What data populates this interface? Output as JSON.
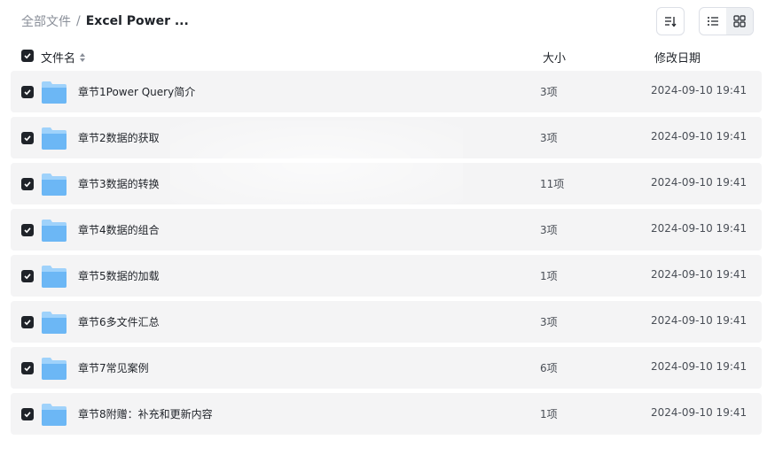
{
  "breadcrumb": {
    "root": "全部文件",
    "separator": "/",
    "current": "Excel Power ..."
  },
  "toolbar": {
    "sort_icon": "sort-icon",
    "list_view_icon": "list-view-icon",
    "grid_view_icon": "grid-view-icon",
    "active_view": "list"
  },
  "table": {
    "headers": {
      "name": "文件名",
      "size": "大小",
      "date": "修改日期"
    },
    "rows": [
      {
        "name": "章节1Power Query简介",
        "size": "3项",
        "date": "2024-09-10 19:41"
      },
      {
        "name": "章节2数据的获取",
        "size": "3项",
        "date": "2024-09-10 19:41"
      },
      {
        "name": "章节3数据的转换",
        "size": "11项",
        "date": "2024-09-10 19:41"
      },
      {
        "name": "章节4数据的组合",
        "size": "3项",
        "date": "2024-09-10 19:41"
      },
      {
        "name": "章节5数据的加载",
        "size": "1项",
        "date": "2024-09-10 19:41"
      },
      {
        "name": "章节6多文件汇总",
        "size": "3项",
        "date": "2024-09-10 19:41"
      },
      {
        "name": "章节7常见案例",
        "size": "6项",
        "date": "2024-09-10 19:41"
      },
      {
        "name": "章节8附赠：补充和更新内容",
        "size": "1项",
        "date": "2024-09-10 19:41"
      }
    ]
  },
  "colors": {
    "row_bg": "#f4f4f5",
    "checkbox": "#1f2329",
    "folder_top": "#9fd2fb",
    "folder_body": "#6cb7f5"
  }
}
